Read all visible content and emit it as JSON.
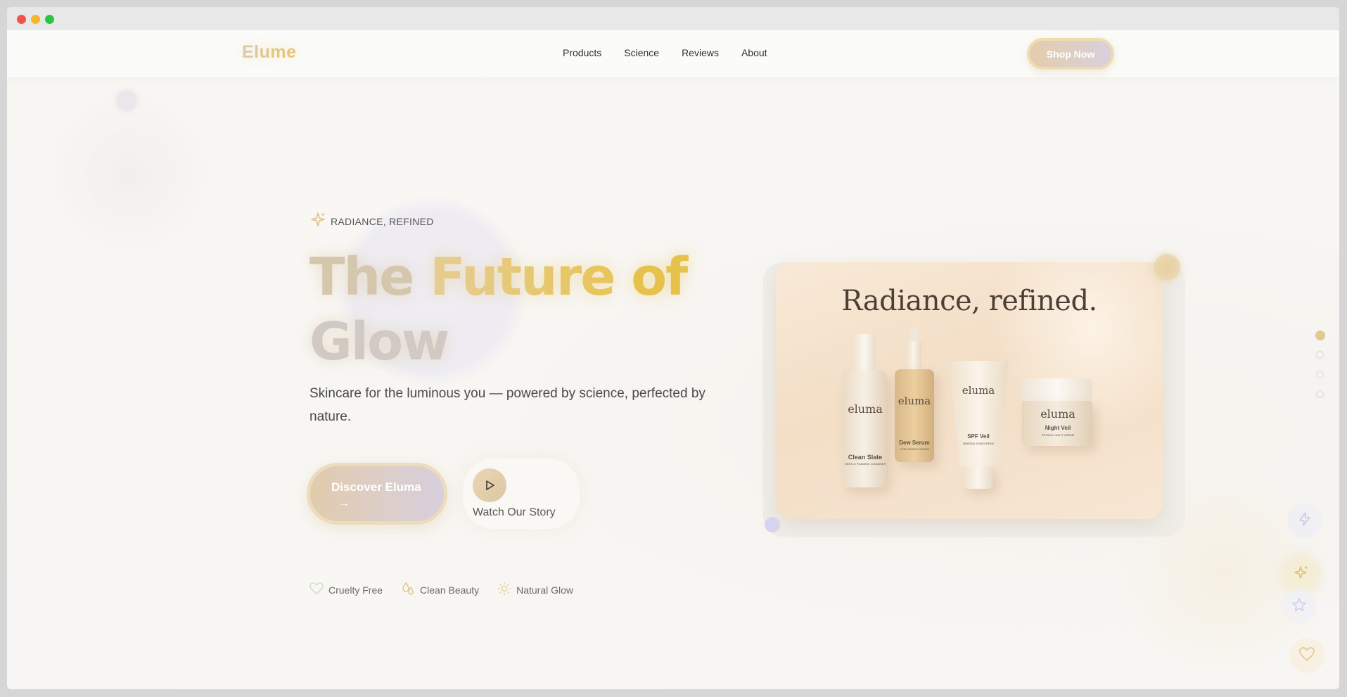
{
  "brand": {
    "logo": "Elume"
  },
  "nav": {
    "links": [
      "Products",
      "Science",
      "Reviews",
      "About"
    ],
    "cta": "Shop Now"
  },
  "hero": {
    "eyebrow": "RADIANCE, REFINED",
    "headline": {
      "word1": "The",
      "word2": "Future",
      "word3": "of",
      "word4": "Glow"
    },
    "subhead": "Skincare for the luminous you — powered by science, perfected by nature.",
    "primary_cta": "Discover Eluma",
    "primary_cta_arrow": "→",
    "secondary_cta": "Watch Our Story",
    "badges": [
      "Cruelty Free",
      "Clean Beauty",
      "Natural Glow"
    ]
  },
  "product_card": {
    "title": "Radiance, refined.",
    "products": [
      {
        "brand": "eluma",
        "name": "Clean Slate",
        "sub": "GENTLE FOAMING CLEANSER"
      },
      {
        "brand": "eluma",
        "name": "Dew Serum",
        "sub": "HYALURONIC SERUM"
      },
      {
        "brand": "eluma",
        "name": "SPF Veil",
        "sub": "MINERAL SUNSCREEN"
      },
      {
        "brand": "eluma",
        "name": "Night Veil",
        "sub": "RETINOL NIGHT CREAM"
      }
    ]
  },
  "pager": {
    "count": 4,
    "active_index": 0
  },
  "floating_actions": [
    "lightning-icon",
    "sparkle-icon",
    "star-icon",
    "heart-icon"
  ],
  "colors": {
    "accent_gold": "#e6c24c",
    "accent_beige": "#e2ccad",
    "accent_lavender": "#d7cfde",
    "text_dark": "#2f2f2f"
  }
}
